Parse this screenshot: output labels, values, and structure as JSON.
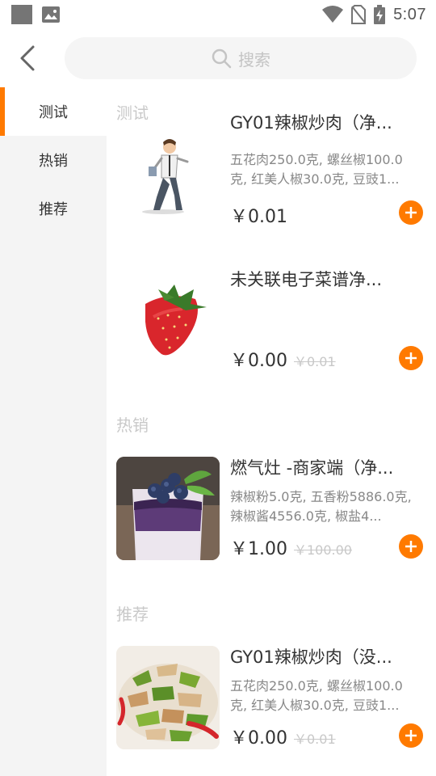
{
  "status_bar": {
    "time": "5:07"
  },
  "search": {
    "placeholder": "搜索"
  },
  "sidebar": {
    "items": [
      {
        "label": "测试",
        "active": true
      },
      {
        "label": "热销",
        "active": false
      },
      {
        "label": "推荐",
        "active": false
      }
    ]
  },
  "sections": [
    {
      "title": "测试",
      "products": [
        {
          "name": "GY01辣椒炒肉（净...",
          "desc": "五花肉250.0克, 螺丝椒100.0克, 红美人椒30.0克, 豆豉1...",
          "price": "￥0.01",
          "old_price": "",
          "image": "running-man-image"
        },
        {
          "name": "未关联电子菜谱净...",
          "desc": "",
          "price": "￥0.00",
          "old_price": "￥0.01",
          "image": "strawberry-image"
        }
      ]
    },
    {
      "title": "热销",
      "products": [
        {
          "name": "燃气灶 -商家端（净...",
          "desc": "辣椒粉5.0克, 五香粉5886.0克, 辣椒酱4556.0克, 椒盐4...",
          "price": "￥1.00",
          "old_price": "￥100.00",
          "image": "blueberry-dessert-image"
        }
      ]
    },
    {
      "title": "推荐",
      "products": [
        {
          "name": "GY01辣椒炒肉（没...",
          "desc": "五花肉250.0克, 螺丝椒100.0克, 红美人椒30.0克, 豆豉1...",
          "price": "￥0.00",
          "old_price": "￥0.01",
          "image": "stir-fry-image"
        }
      ]
    }
  ],
  "colors": {
    "accent": "#ff7a00",
    "sidebar_bg": "#f4f4f4",
    "search_bg": "#f5f5f5"
  }
}
